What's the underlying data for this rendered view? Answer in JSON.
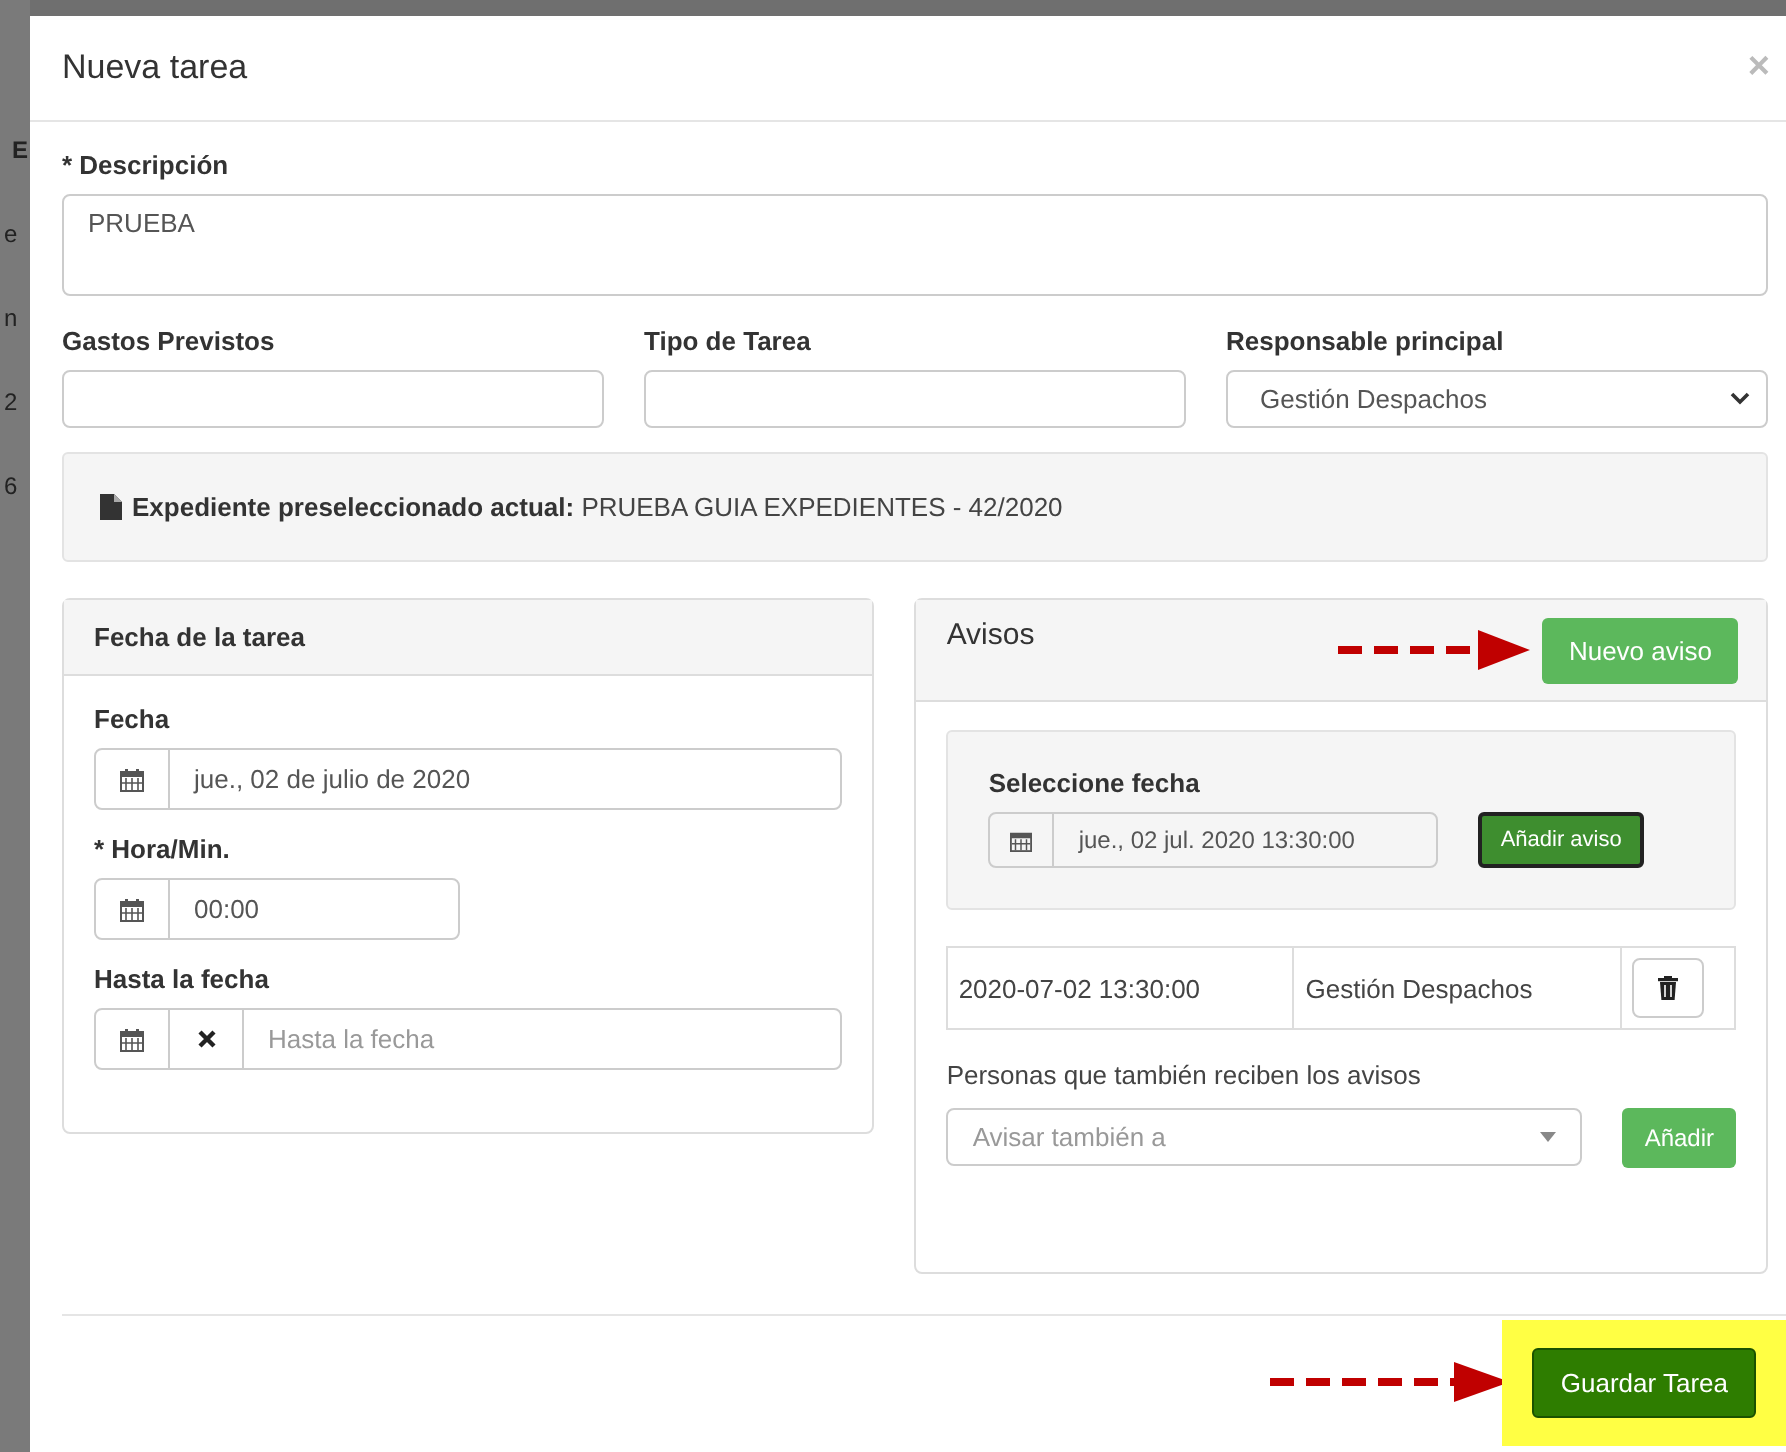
{
  "backdrop_fragments": [
    "E",
    "e",
    "n",
    "2",
    "6"
  ],
  "modal": {
    "title": "Nueva tarea",
    "close": "×"
  },
  "description": {
    "label": "* Descripción",
    "value": "PRUEBA"
  },
  "fields": [
    {
      "kind": "text",
      "label": "Gastos Previstos"
    },
    {
      "kind": "text",
      "label": "Tipo de Tarea"
    },
    {
      "kind": "select",
      "label": "Responsable principal",
      "value": "Gestión Despachos"
    }
  ],
  "expediente": {
    "label": "Expediente preseleccionado actual:",
    "value": "PRUEBA GUIA EXPEDIENTES - 42/2020"
  },
  "fecha_panel": {
    "title": "Fecha de la tarea",
    "fields": [
      {
        "kind": "date",
        "label": "Fecha",
        "value": "jue., 02 de julio de 2020",
        "clearable": false
      },
      {
        "kind": "time",
        "label": "* Hora/Min.",
        "value": "00:00",
        "clearable": false
      },
      {
        "kind": "date",
        "label": "Hasta la fecha",
        "placeholder": "Hasta la fecha",
        "clearable": true
      }
    ]
  },
  "avisos": {
    "title": "Avisos",
    "new_button": "Nuevo aviso",
    "picker_label": "Seleccione fecha",
    "picker_value": "jue., 02 jul. 2020 13:30:00",
    "add_button": "Añadir aviso",
    "rows": [
      {
        "datetime": "2020-07-02 13:30:00",
        "person": "Gestión Despachos"
      }
    ],
    "recipients_label": "Personas que también reciben los avisos",
    "recipients_placeholder": "Avisar también a",
    "recipients_button": "Añadir"
  },
  "footer": {
    "save_button": "Guardar Tarea",
    "highlighted": true
  }
}
